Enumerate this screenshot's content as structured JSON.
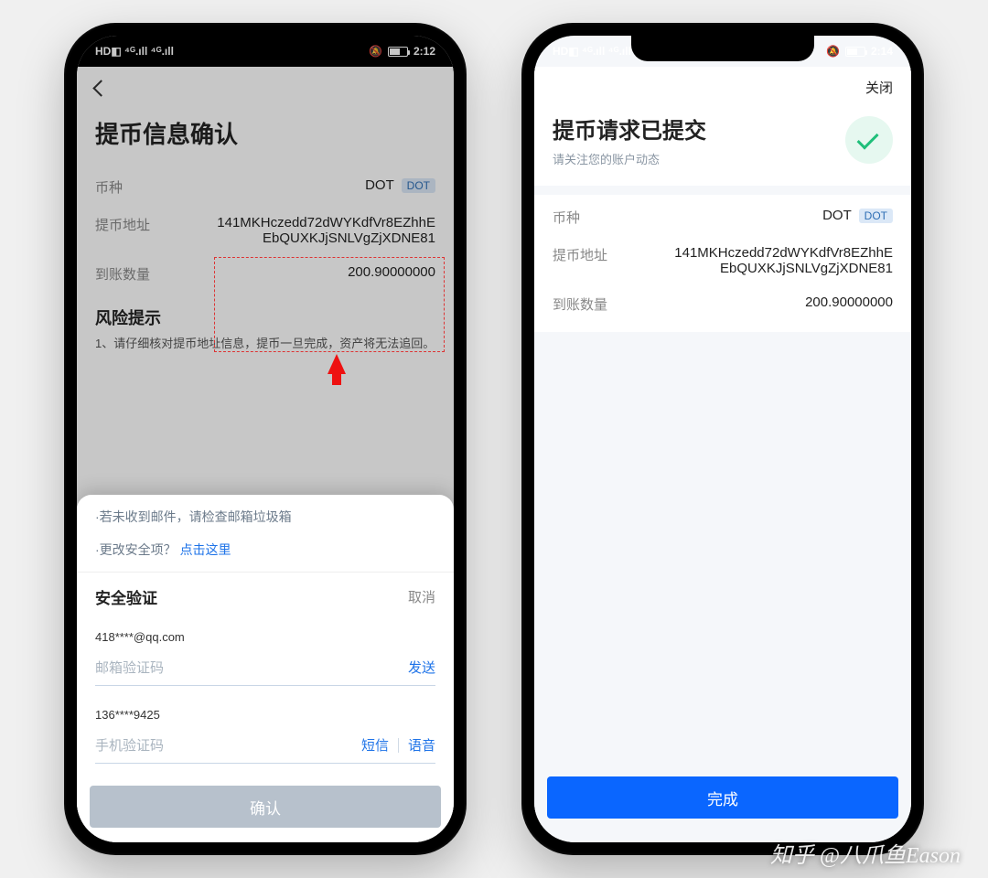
{
  "statusbar": {
    "indicator": "HD◧ ⁴ᴳ.ıll ⁴ᴳ.ıll",
    "bell": "🔕",
    "time_left": "2:12",
    "time_right": "2:14"
  },
  "left": {
    "title": "提币信息确认",
    "rows": {
      "coin_label": "币种",
      "coin_val": "DOT",
      "coin_badge": "DOT",
      "addr_label": "提币地址",
      "addr_val": "141MKHczedd72dWYKdfVr8EZhhEEbQUXKJjSNLVgZjXDNE81",
      "amount_label": "到账数量",
      "amount_val": "200.90000000"
    },
    "risk_title": "风险提示",
    "risk_body": "1、请仔细核对提币地址信息，提币一旦完成，资产将无法追回。",
    "sheet": {
      "note1": "·若未收到邮件，请检查邮箱垃圾箱",
      "note2_prefix": "·更改安全项？",
      "note2_link": "点击这里",
      "title": "安全验证",
      "cancel": "取消",
      "email_id": "418****@qq.com",
      "email_ph": "邮箱验证码",
      "email_send": "发送",
      "phone_id": "136****9425",
      "phone_ph": "手机验证码",
      "phone_sms": "短信",
      "phone_voice": "语音",
      "confirm": "确认"
    }
  },
  "right": {
    "close": "关闭",
    "title": "提币请求已提交",
    "subtitle": "请关注您的账户动态",
    "rows": {
      "coin_label": "币种",
      "coin_val": "DOT",
      "coin_badge": "DOT",
      "addr_label": "提币地址",
      "addr_val": "141MKHczedd72dWYKdfVr8EZhhEEbQUXKJjSNLVgZjXDNE81",
      "amount_label": "到账数量",
      "amount_val": "200.90000000"
    },
    "done": "完成"
  },
  "watermark": "知乎 @八爪鱼Eason"
}
